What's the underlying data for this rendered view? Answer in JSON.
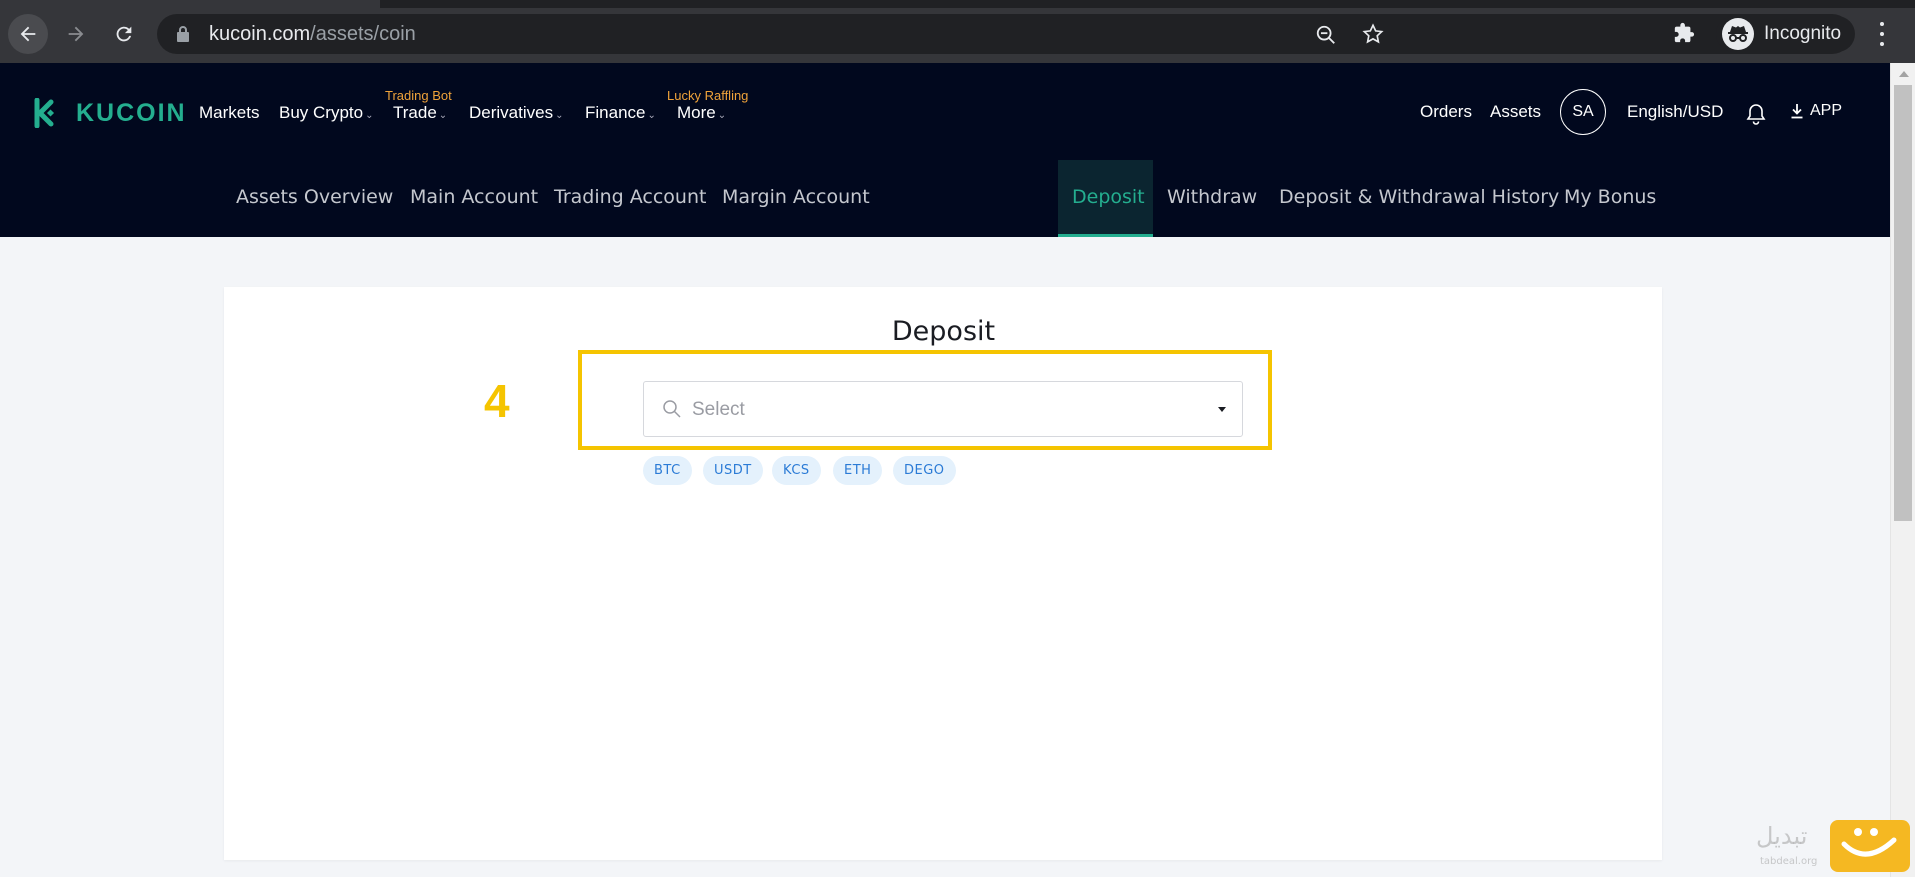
{
  "browser": {
    "url_host": "kucoin.com",
    "url_path": "/assets/coin",
    "profile_label": "Incognito"
  },
  "header": {
    "brand": "KUCOIN",
    "nav": [
      {
        "label": "Markets",
        "has_dropdown": false
      },
      {
        "label": "Buy Crypto",
        "has_dropdown": true
      },
      {
        "label": "Trade",
        "has_dropdown": true,
        "promo": "Trading Bot"
      },
      {
        "label": "Derivatives",
        "has_dropdown": true
      },
      {
        "label": "Finance",
        "has_dropdown": true
      },
      {
        "label": "More",
        "has_dropdown": true,
        "promo": "Lucky Raffling"
      }
    ],
    "orders_label": "Orders",
    "assets_label": "Assets",
    "user_initials": "SA",
    "language": "English/USD",
    "app_label": "APP"
  },
  "subnav": {
    "items": [
      {
        "label": "Assets Overview"
      },
      {
        "label": "Main Account"
      },
      {
        "label": "Trading Account"
      },
      {
        "label": "Margin Account"
      },
      {
        "label": "Deposit",
        "active": true
      },
      {
        "label": "Withdraw"
      },
      {
        "label": "Deposit & Withdrawal History"
      },
      {
        "label": "My Bonus"
      }
    ]
  },
  "deposit": {
    "title": "Deposit",
    "select_placeholder": "Select",
    "quick_coins": [
      "BTC",
      "USDT",
      "KCS",
      "ETH",
      "DEGO"
    ]
  },
  "annotation": {
    "step_number": "4",
    "highlight_color": "#f5c400"
  },
  "watermark": {
    "text": "تبدیل",
    "sub": "tabdeal.org"
  },
  "colors": {
    "brand": "#24ae8f",
    "header_bg": "#01081e",
    "promo": "#f0a33a",
    "chip_bg": "#e4f1fc",
    "chip_text": "#2b7bd6"
  }
}
